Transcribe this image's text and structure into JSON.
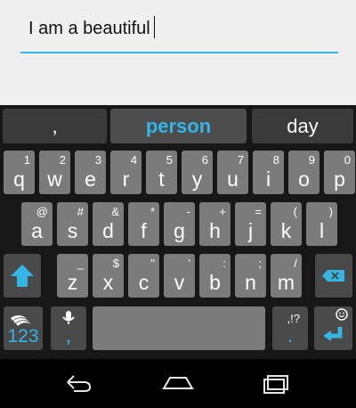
{
  "input": {
    "value": "I am a beautiful"
  },
  "suggestions": [
    ",",
    "person",
    "day"
  ],
  "keyboard": {
    "row1": [
      {
        "num": "1",
        "key": "q"
      },
      {
        "num": "2",
        "key": "w"
      },
      {
        "num": "3",
        "key": "e"
      },
      {
        "num": "4",
        "key": "r"
      },
      {
        "num": "5",
        "key": "t"
      },
      {
        "num": "6",
        "key": "y"
      },
      {
        "num": "7",
        "key": "u"
      },
      {
        "num": "8",
        "key": "i"
      },
      {
        "num": "9",
        "key": "o"
      },
      {
        "num": "0",
        "key": "p"
      }
    ],
    "row2": [
      {
        "num": "@",
        "key": "a"
      },
      {
        "num": "#",
        "key": "s"
      },
      {
        "num": "&",
        "key": "d"
      },
      {
        "num": "*",
        "key": "f"
      },
      {
        "num": "-",
        "key": "g"
      },
      {
        "num": "+",
        "key": "h"
      },
      {
        "num": "=",
        "key": "j"
      },
      {
        "num": "(",
        "key": "k"
      },
      {
        "num": ")",
        "key": "l"
      }
    ],
    "row3": [
      {
        "num": "_",
        "key": "z"
      },
      {
        "num": "$",
        "key": "x"
      },
      {
        "num": "\"",
        "key": "c"
      },
      {
        "num": "'",
        "key": "v"
      },
      {
        "num": ":",
        "key": "b"
      },
      {
        "num": ";",
        "key": "n"
      },
      {
        "num": "/",
        "key": "m"
      }
    ],
    "bottom": {
      "numbers_label": "123",
      "comma_label": ",",
      "period_label": ".",
      "punct_hint": ",!?"
    }
  },
  "colors": {
    "accent": "#33b5e5",
    "key_bg": "#7b7b7b",
    "key_dark_bg": "#4a4a4a"
  }
}
